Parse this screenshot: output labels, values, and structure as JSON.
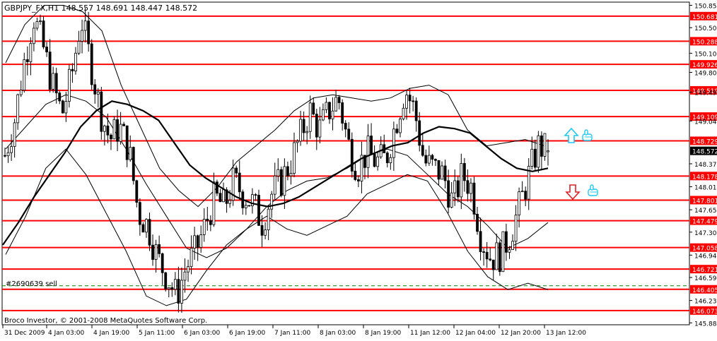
{
  "header": {
    "symbol_line": "GBPJPY_FX,H1  148.557 148.691 148.447 148.572"
  },
  "footer": {
    "copyright": "Broco Investor, © 2001-2008 MetaQuotes Software Corp."
  },
  "order_label": "#2690639 sell",
  "colors": {
    "level_line": "#ff0000",
    "level_label_bg": "#ff0000",
    "current_price_bg": "#000000",
    "order_line": "#008000",
    "candles": "#000000",
    "arrow_up": "#1ec8f0",
    "arrow_down": "#e02020",
    "hand_icon": "#1ec8f0"
  },
  "icons": {
    "up_arrow": "up-arrow-icon",
    "down_arrow": "down-arrow-icon",
    "hand_up": "thumbs-up-hand-icon",
    "hand_down": "thumbs-down-hand-icon"
  },
  "chart_data": {
    "type": "candlestick",
    "symbol": "GBPJPY_FX",
    "timeframe": "H1",
    "ohlc_last": {
      "open": 148.557,
      "high": 148.691,
      "low": 148.447,
      "close": 148.572
    },
    "current_price_label": "148.572",
    "current_price": 148.572,
    "ylim": [
      145.85,
      150.9
    ],
    "y_ticks": [
      {
        "value": 150.85,
        "label": "150.850"
      },
      {
        "value": 150.5,
        "label": "150.500"
      },
      {
        "value": 150.1,
        "label": "150.100"
      },
      {
        "value": 149.8,
        "label": "149.800"
      },
      {
        "value": 149.49,
        "label": "149.490"
      },
      {
        "value": 149.04,
        "label": "149.040"
      },
      {
        "value": 148.37,
        "label": "148.370"
      },
      {
        "value": 148.01,
        "label": "148.010"
      },
      {
        "value": 147.65,
        "label": "147.650"
      },
      {
        "value": 147.3,
        "label": "147.300"
      },
      {
        "value": 146.94,
        "label": "146.940"
      },
      {
        "value": 146.59,
        "label": "146.590"
      },
      {
        "value": 146.23,
        "label": "146.230"
      },
      {
        "value": 145.88,
        "label": "145.880"
      }
    ],
    "x_ticks": [
      "31 Dec 2009",
      "4 Jan 03:00",
      "4 Jan 19:00",
      "5 Jan 11:00",
      "6 Jan 03:00",
      "6 Jan 19:00",
      "7 Jan 11:00",
      "8 Jan 03:00",
      "8 Jan 19:00",
      "11 Jan 12:00",
      "12 Jan 04:00",
      "12 Jan 20:00",
      "13 Jan 12:00"
    ],
    "levels": [
      {
        "value": 150.681,
        "label": "150.681"
      },
      {
        "value": 150.288,
        "label": "150.288"
      },
      {
        "value": 149.926,
        "label": "149.926"
      },
      {
        "value": 149.519,
        "label": "149.519"
      },
      {
        "value": 149.109,
        "label": "149.109"
      },
      {
        "value": 148.729,
        "label": "148.729"
      },
      {
        "value": 148.178,
        "label": "148.178"
      },
      {
        "value": 147.801,
        "label": "147.801"
      },
      {
        "value": 147.479,
        "label": "147.479"
      },
      {
        "value": 147.058,
        "label": "147.058"
      },
      {
        "value": 146.721,
        "label": "146.721"
      },
      {
        "value": 146.405,
        "label": "146.405"
      },
      {
        "value": 146.073,
        "label": "146.073"
      }
    ],
    "order_level": 146.46,
    "close_path": [
      148.5,
      149.05,
      149.95,
      150.68,
      150.2,
      149.6,
      149.15,
      149.75,
      150.65,
      149.95,
      149.2,
      148.75,
      148.95,
      148.6,
      147.6,
      147.4,
      146.9,
      146.6,
      146.3,
      146.75,
      147.0,
      147.4,
      147.85,
      147.7,
      148.1,
      147.9,
      147.75,
      147.45,
      147.9,
      148.1,
      148.4,
      148.8,
      149.2,
      148.9,
      149.2,
      149.4,
      148.7,
      148.3,
      148.55,
      148.4,
      148.45,
      149.0,
      149.55,
      149.2,
      148.4,
      148.3,
      148.2,
      147.75,
      148.2,
      148.0,
      147.2,
      146.9,
      146.95,
      147.25,
      147.7,
      148.2,
      148.65,
      148.57
    ],
    "ma_path": [
      147.1,
      147.45,
      147.85,
      148.2,
      148.55,
      148.95,
      149.2,
      149.35,
      149.3,
      149.2,
      149.05,
      148.7,
      148.35,
      148.15,
      148.0,
      147.85,
      147.75,
      147.7,
      147.75,
      147.85,
      148.0,
      148.15,
      148.3,
      148.45,
      148.55,
      148.65,
      148.7,
      148.85,
      148.95,
      148.92,
      148.85,
      148.65,
      148.45,
      148.3,
      148.25,
      148.3
    ],
    "bb_upper": [
      149.95,
      150.55,
      150.85,
      150.85,
      150.75,
      150.45,
      149.6,
      148.95,
      148.3,
      147.95,
      147.7,
      148.0,
      148.4,
      148.65,
      148.9,
      149.2,
      149.4,
      149.45,
      149.4,
      149.35,
      149.4,
      149.55,
      149.6,
      149.45,
      148.9,
      148.65,
      148.7,
      148.75,
      148.65
    ],
    "bb_lower": [
      146.95,
      147.55,
      148.3,
      148.6,
      148.2,
      147.6,
      147.0,
      146.3,
      146.15,
      146.25,
      146.7,
      147.1,
      147.35,
      147.55,
      147.35,
      147.25,
      147.4,
      147.55,
      147.9,
      148.05,
      148.2,
      148.1,
      147.6,
      147.0,
      146.6,
      146.4,
      146.5,
      146.4
    ],
    "bb_mid": [
      148.6,
      148.95,
      149.3,
      149.45,
      149.35,
      149.1,
      148.6,
      148.05,
      147.55,
      147.05,
      146.9,
      147.05,
      147.35,
      147.7,
      147.95,
      148.1,
      148.15,
      148.3,
      148.5,
      148.6,
      148.5,
      148.2,
      147.9,
      147.7,
      147.4,
      147.05,
      147.2,
      147.45
    ]
  }
}
